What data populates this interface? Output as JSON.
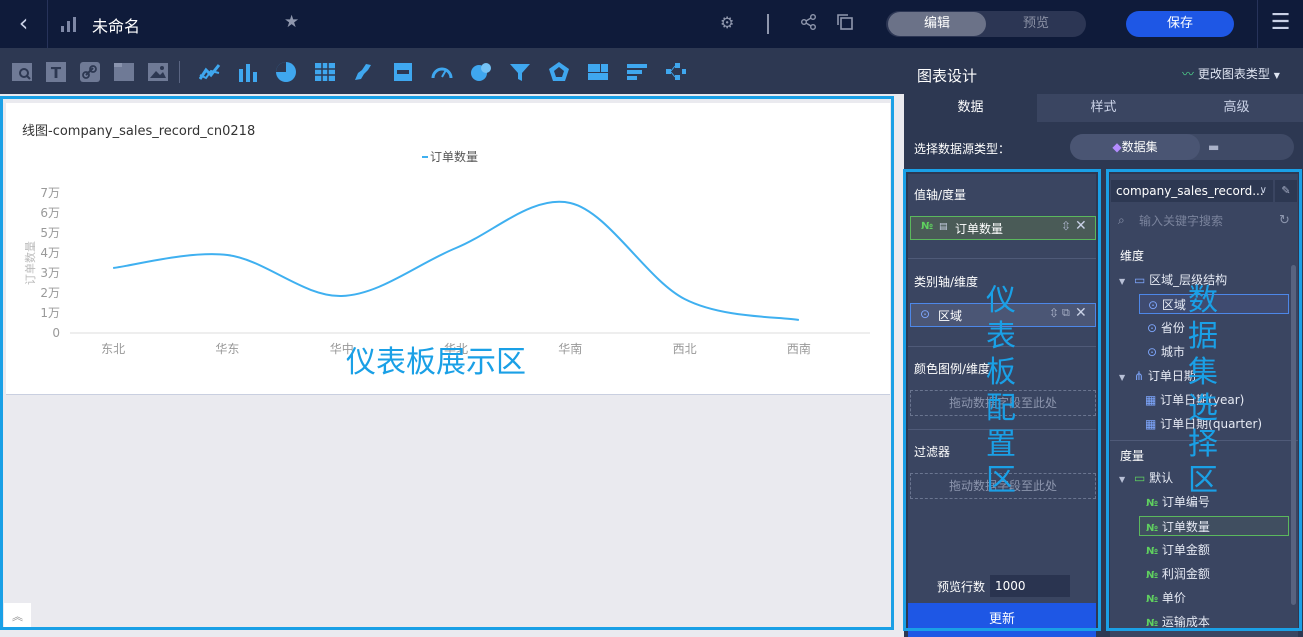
{
  "header": {
    "title": "未命名",
    "mode_edit": "编辑",
    "mode_preview": "预览",
    "save_label": "保存"
  },
  "chart_card": {
    "title": "线图-company_sales_record_cn0218"
  },
  "chart_data": {
    "type": "line",
    "categories": [
      "东北",
      "华东",
      "华中",
      "华北",
      "华南",
      "西北",
      "西南"
    ],
    "series": [
      {
        "name": "订单数量",
        "values": [
          32500,
          39000,
          18500,
          42500,
          65000,
          17000,
          6500
        ]
      }
    ],
    "ylabel": "订单数量",
    "xlabel": "",
    "ylim": [
      0,
      70000
    ],
    "ytick_labels": [
      "0",
      "1万",
      "2万",
      "3万",
      "4万",
      "5万",
      "6万",
      "7万"
    ],
    "legend": "top-center",
    "grid": false,
    "smooth": true,
    "color": "#3fb0f0"
  },
  "annotations": {
    "display_area": "仪表板展示区",
    "config_area": [
      "仪",
      "表",
      "板",
      "配",
      "置",
      "区"
    ],
    "dataset_area": [
      "数",
      "据",
      "集",
      "选",
      "择",
      "区"
    ]
  },
  "right_panel": {
    "title": "图表设计",
    "change_type": "更改图表类型",
    "tabs": [
      "数据",
      "样式",
      "高级"
    ],
    "source_label": "选择数据源类型：",
    "source_dataset": "数据集"
  },
  "config": {
    "value_axis_label": "值轴/度量",
    "value_field": "订单数量",
    "category_axis_label": "类别轴/维度",
    "category_field": "区域",
    "color_legend_label": "颜色图例/维度",
    "drop_hint_color": "拖动数据字段至此处",
    "filter_label": "过滤器",
    "drop_hint_filter": "拖动数据字段至此处",
    "preview_rows_label": "预览行数",
    "preview_rows_value": "1000",
    "update_label": "更新"
  },
  "dataset": {
    "selected": "company_sales_record...",
    "search_placeholder": "输入关键字搜索",
    "dimensions_label": "维度",
    "dim_items": [
      {
        "label": "区域_层级结构"
      },
      {
        "label": "区域"
      },
      {
        "label": "省份"
      },
      {
        "label": "城市"
      },
      {
        "label": "订单日期"
      },
      {
        "label": "订单日期(year)"
      },
      {
        "label": "订单日期(quarter)"
      }
    ],
    "measures_label": "度量",
    "measure_group": "默认",
    "measure_items": [
      {
        "label": "订单编号"
      },
      {
        "label": "订单数量"
      },
      {
        "label": "订单金额"
      },
      {
        "label": "利润金额"
      },
      {
        "label": "单价"
      },
      {
        "label": "运输成本"
      }
    ]
  }
}
